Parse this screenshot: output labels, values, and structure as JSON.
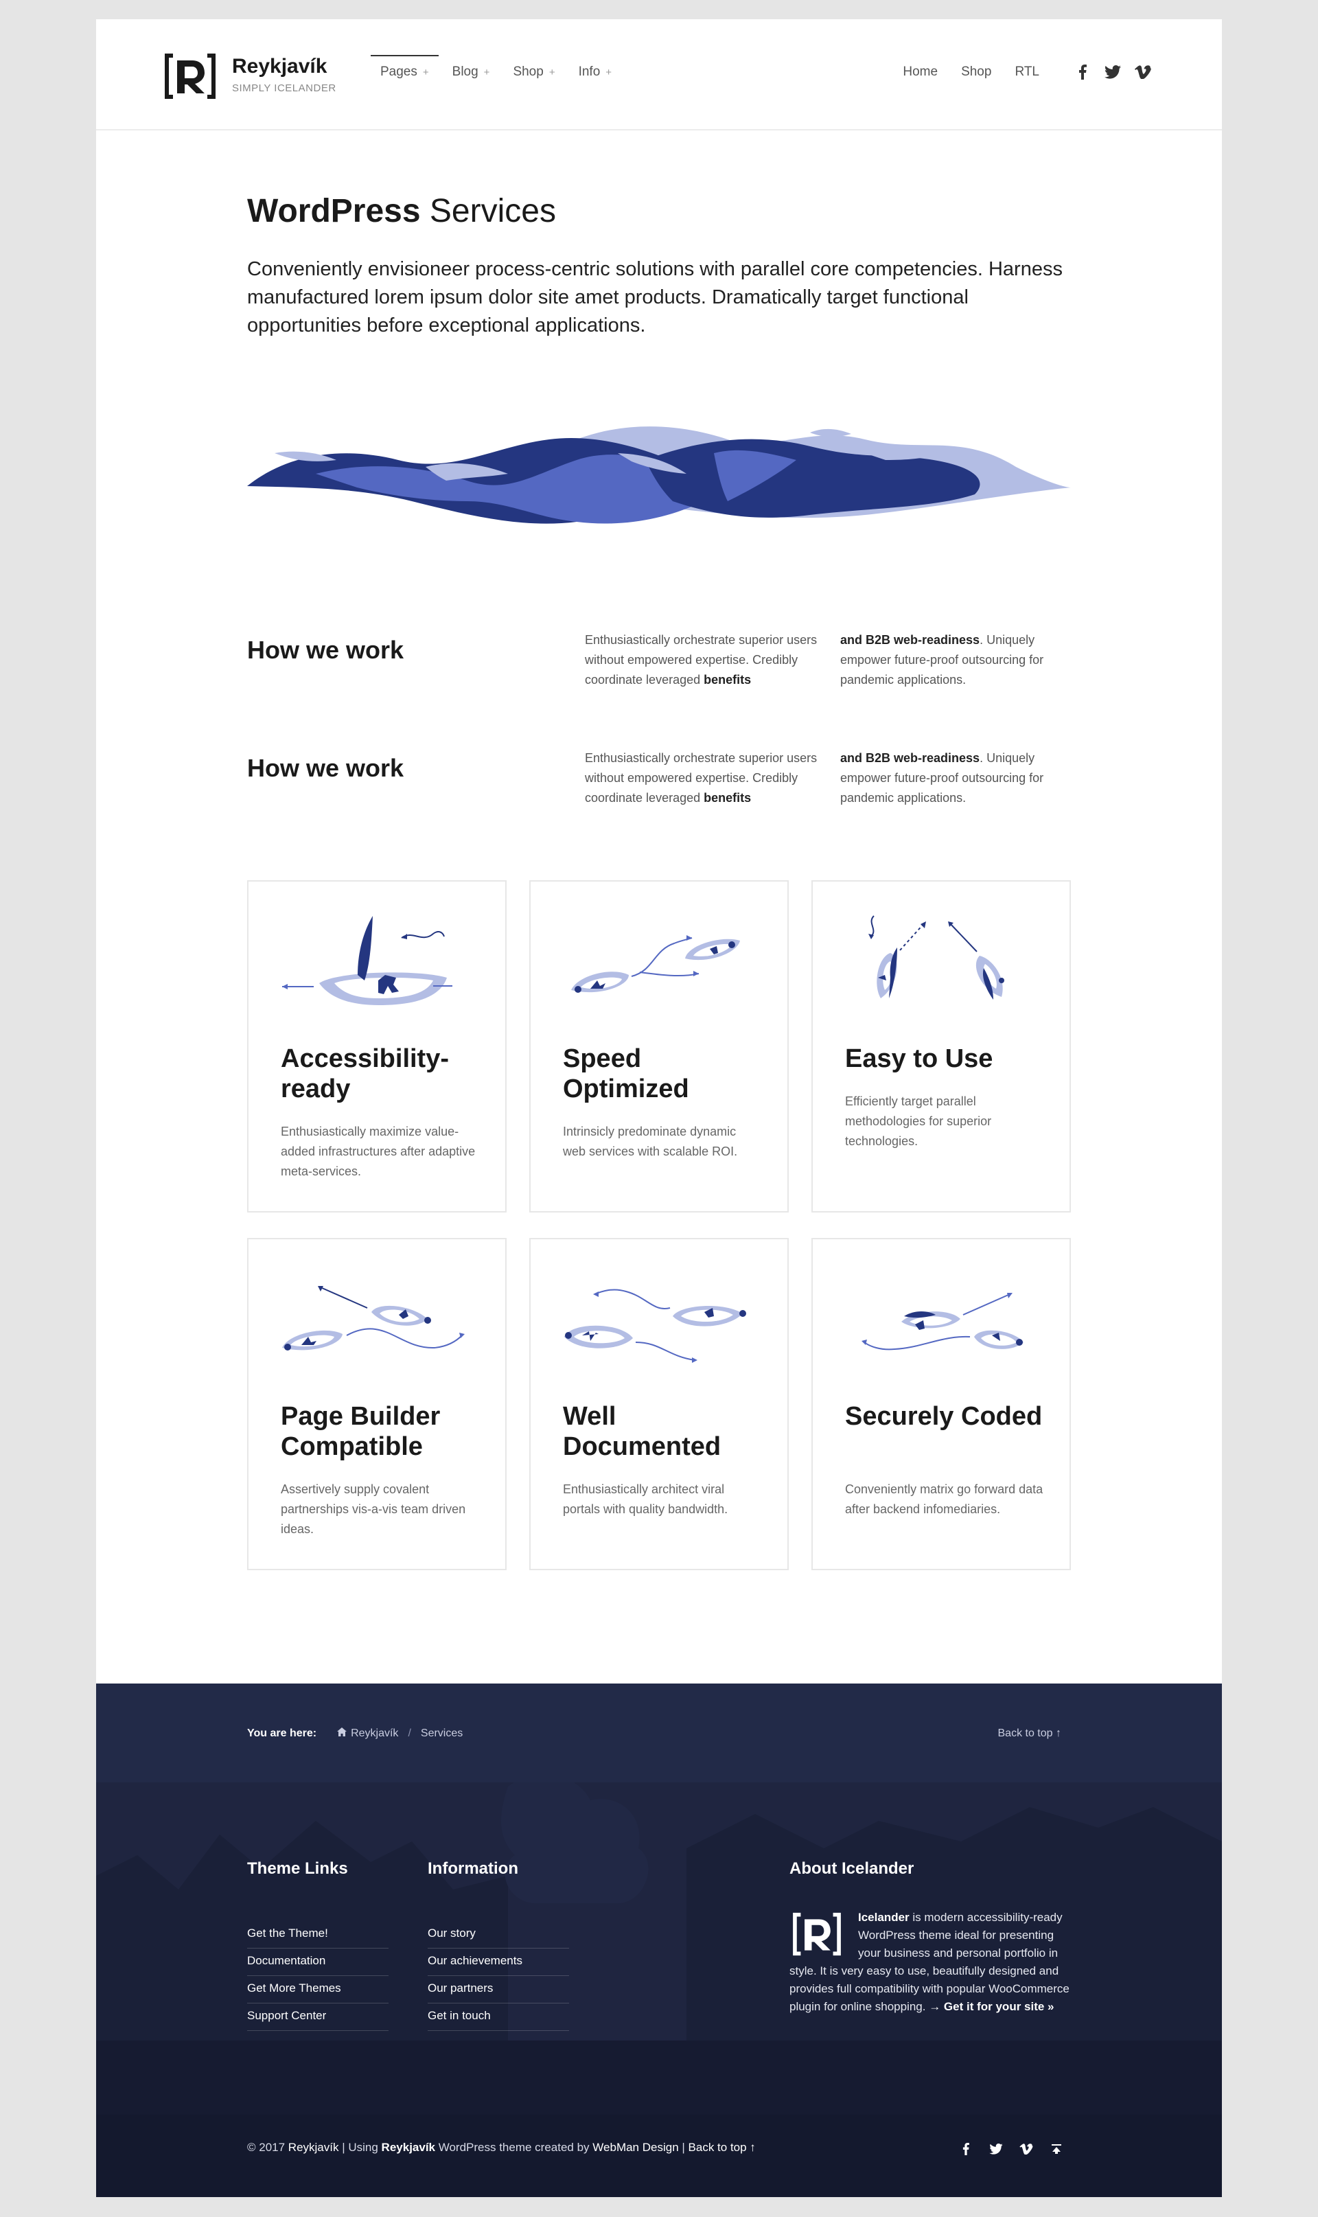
{
  "header": {
    "brand_name": "Reykjavík",
    "brand_tagline": "SIMPLY ICELANDER",
    "nav": [
      {
        "label": "Pages",
        "active": true
      },
      {
        "label": "Blog",
        "active": false
      },
      {
        "label": "Shop",
        "active": false
      },
      {
        "label": "Info",
        "active": false
      }
    ],
    "top_links": [
      "Home",
      "Shop",
      "RTL"
    ],
    "social_icons": [
      "facebook-icon",
      "twitter-icon",
      "vimeo-icon"
    ]
  },
  "hero": {
    "title_bold": "WordPress",
    "title_light": " Services",
    "intro": "Conveniently envisioneer process-centric solutions with parallel core competencies. Harness manufactured lorem ipsum dolor site amet products. Dramatically target functional opportunities before exceptional applications."
  },
  "how": [
    {
      "heading": "How we work",
      "col1_text": "Enthusiastically orchestrate superior users without empowered expertise. Credibly coordinate leveraged ",
      "col1_bold": "benefits",
      "col2_bold": "and B2B web-readiness",
      "col2_text": ". Uniquely empower future-proof outsourcing for pandemic applications."
    },
    {
      "heading": "How we work",
      "col1_text": "Enthusiastically orchestrate superior users without empowered expertise. Credibly coordinate leveraged ",
      "col1_bold": "benefits",
      "col2_bold": "and B2B web-readiness",
      "col2_text": ". Uniquely empower future-proof outsourcing for pandemic applications."
    }
  ],
  "features": [
    {
      "title": "Accessibility-ready",
      "text": "Enthusiastically maximize value-added infrastructures after adaptive meta-services.",
      "icon": "sailboat-icon"
    },
    {
      "title": "Speed Optimized",
      "text": "Intrinsicly predominate dynamic web services with scalable ROI.",
      "icon": "boats-diverging-icon"
    },
    {
      "title": "Easy to Use",
      "text": "Efficiently target parallel methodologies for superior technologies.",
      "icon": "boats-converging-icon"
    },
    {
      "title": "Page Builder Compatible",
      "text": "Assertively supply covalent partnerships vis-a-vis team driven ideas.",
      "icon": "boats-crossing-icon"
    },
    {
      "title": "Well Documented",
      "text": "Enthusiastically architect viral portals with quality bandwidth.",
      "icon": "boats-route-icon"
    },
    {
      "title": "Securely Coded",
      "text": "Conveniently matrix go forward data after backend infomediaries.",
      "icon": "boats-convoy-icon"
    }
  ],
  "footer": {
    "breadcrumb_label": "You are here:",
    "breadcrumb_home": "Reykjavík",
    "breadcrumb_sep": "/",
    "breadcrumb_current": "Services",
    "back_to_top": "Back to top ↑",
    "theme_links_title": "Theme Links",
    "theme_links": [
      "Get the Theme!",
      "Documentation",
      "Get More Themes",
      "Support Center"
    ],
    "information_title": "Information",
    "information_links": [
      "Our story",
      "Our achievements",
      "Our partners",
      "Get in touch"
    ],
    "about_title": "About Icelander",
    "about_bold": "Icelander",
    "about_text": " is modern accessibility-ready WordPress theme ideal for presenting your business and personal portfolio in style. It is very easy to use, beautifully designed and provides full compatibility with popular WooCommerce plugin for online shopping. ",
    "about_link": "→ Get it for your site »",
    "copyright_prefix": "© 2017 ",
    "copyright_site": "Reykjavík",
    "copyright_mid1": " | Using ",
    "copyright_theme": "Reykjavík",
    "copyright_mid2": " WordPress theme created by ",
    "copyright_author": "WebMan Design",
    "copyright_sep": " | ",
    "copyright_back": "Back to top ↑",
    "social_icons": [
      "facebook-icon",
      "twitter-icon",
      "vimeo-icon",
      "back-to-top-icon"
    ]
  },
  "colors": {
    "accent_dark": "#243680",
    "accent_mid": "#5468c2",
    "accent_light": "#b3bde4",
    "footer_bg": "#1f2540"
  }
}
